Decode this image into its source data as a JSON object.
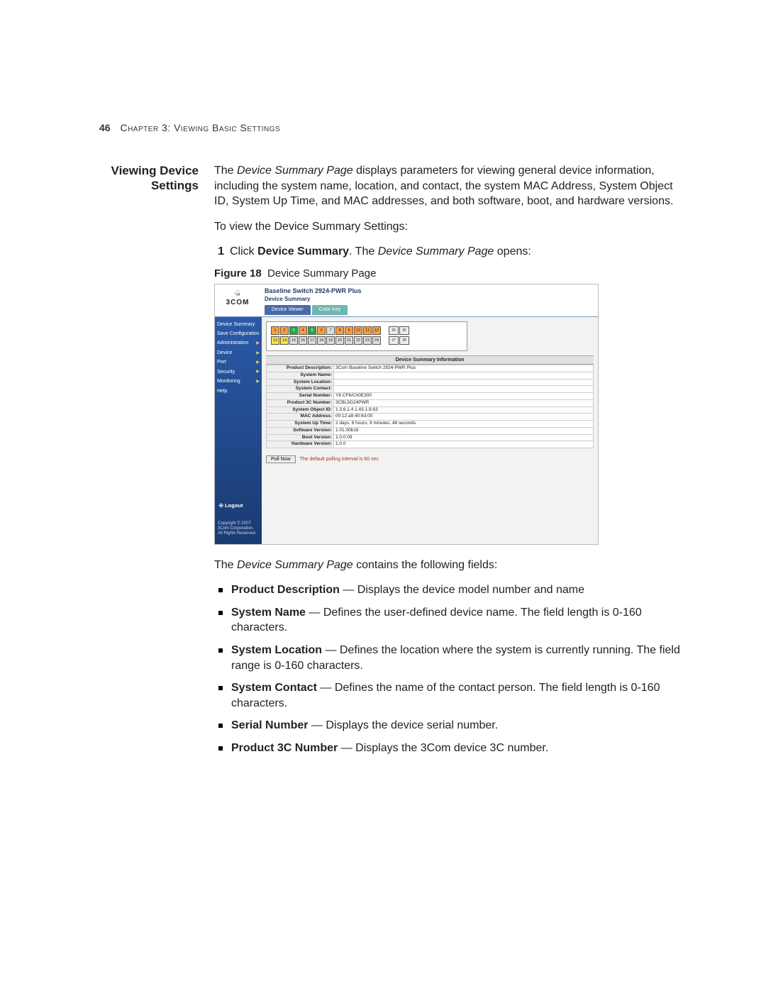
{
  "page_number": "46",
  "chapter_label": "Chapter 3: Viewing Basic Settings",
  "side_heading_line1": "Viewing Device",
  "side_heading_line2": "Settings",
  "intro_para": "The Device Summary Page displays parameters for viewing general device information, including the system name, location, and contact, the system MAC Address, System Object ID, System Up Time, and MAC addresses, and both software, boot, and hardware versions.",
  "intro_emphasis": "Device Summary Page",
  "howto_line": "To view the Device Summary Settings:",
  "step1_num": "1",
  "step1_pre": "Click ",
  "step1_bold": "Device Summary",
  "step1_post": ". The Device Summary Page opens:",
  "step1_em": "Device Summary Page",
  "figure_label": "Figure 18",
  "figure_caption": "Device Summary Page",
  "post_figure_line": "The Device Summary Page contains the following fields:",
  "post_figure_em": "Device Summary Page",
  "fields": [
    {
      "name": "Product Description",
      "desc": " — Displays the device model number and name"
    },
    {
      "name": "System Name",
      "desc": " — Defines the user-defined device name. The field length is 0-160 characters."
    },
    {
      "name": "System Location",
      "desc": " — Defines the location where the system is currently running. The field range is 0-160 characters."
    },
    {
      "name": "System Contact",
      "desc": " — Defines the name of the contact person. The field length is 0-160 characters."
    },
    {
      "name": "Serial Number",
      "desc": " — Displays the device serial number."
    },
    {
      "name": "Product 3C Number",
      "desc": " — Displays the 3Com device 3C number."
    }
  ],
  "screenshot": {
    "brand": "3COM",
    "product_title": "Baseline Switch 2924-PWR Plus",
    "breadcrumb": "Device Summary",
    "tabs": [
      "Device Viewer",
      "Color Key"
    ],
    "nav_items": [
      {
        "label": "Device Summary",
        "expand": false
      },
      {
        "label": "Save Configuration",
        "expand": false
      },
      {
        "label": "Administration",
        "expand": true
      },
      {
        "label": "Device",
        "expand": true
      },
      {
        "label": "Port",
        "expand": true
      },
      {
        "label": "Security",
        "expand": true
      },
      {
        "label": "Monitoring",
        "expand": true
      },
      {
        "label": "Help",
        "expand": false
      }
    ],
    "logout_label": "Logout",
    "copyright": "Copyright © 2007 3Com Corporation. All Rights Reserved.",
    "ports_top": [
      "1",
      "2",
      "3",
      "4",
      "5",
      "6",
      "7",
      "8",
      "9",
      "10",
      "11",
      "12"
    ],
    "ports_bot": [
      "13",
      "14",
      "15",
      "16",
      "17",
      "18",
      "19",
      "20",
      "21",
      "22",
      "23",
      "24"
    ],
    "port_state_top": [
      "o",
      "o",
      "g",
      "o",
      "g",
      "o",
      "grey",
      "o",
      "o",
      "o",
      "o",
      "o"
    ],
    "port_state_bot": [
      "y",
      "y",
      "grey",
      "grey",
      "grey",
      "grey",
      "grey",
      "grey",
      "grey",
      "grey",
      "grey",
      "grey"
    ],
    "uplinks": [
      "25",
      "26",
      "27",
      "28"
    ],
    "summary_header": "Device Summary Information",
    "summary_rows": [
      {
        "k": "Product Description:",
        "v": "3Com Baseline Switch 2924-PWR Plus"
      },
      {
        "k": "System Name:",
        "v": ""
      },
      {
        "k": "System Location:",
        "v": ""
      },
      {
        "k": "System Contact:",
        "v": ""
      },
      {
        "k": "Serial Number:",
        "v": "Y8 CF6/Ch0E300"
      },
      {
        "k": "Product 3C Number:",
        "v": "3CBL5G24PWR"
      },
      {
        "k": "System Object ID:",
        "v": "1.3.6.1.4.1.43.1.8.63"
      },
      {
        "k": "MAC Address:",
        "v": "00:12:a9:40:63:00"
      },
      {
        "k": "System Up Time:",
        "v": "2 days, 8 hours, 9 minutes, 48 seconds"
      },
      {
        "k": "Software Version:",
        "v": "1.01.00b16"
      },
      {
        "k": "Boot Version:",
        "v": "1.0.0.09"
      },
      {
        "k": "Hardware Version:",
        "v": "1.0.0"
      }
    ],
    "poll_button": "Poll Now",
    "poll_message": "The default polling interval is 60 sec"
  }
}
